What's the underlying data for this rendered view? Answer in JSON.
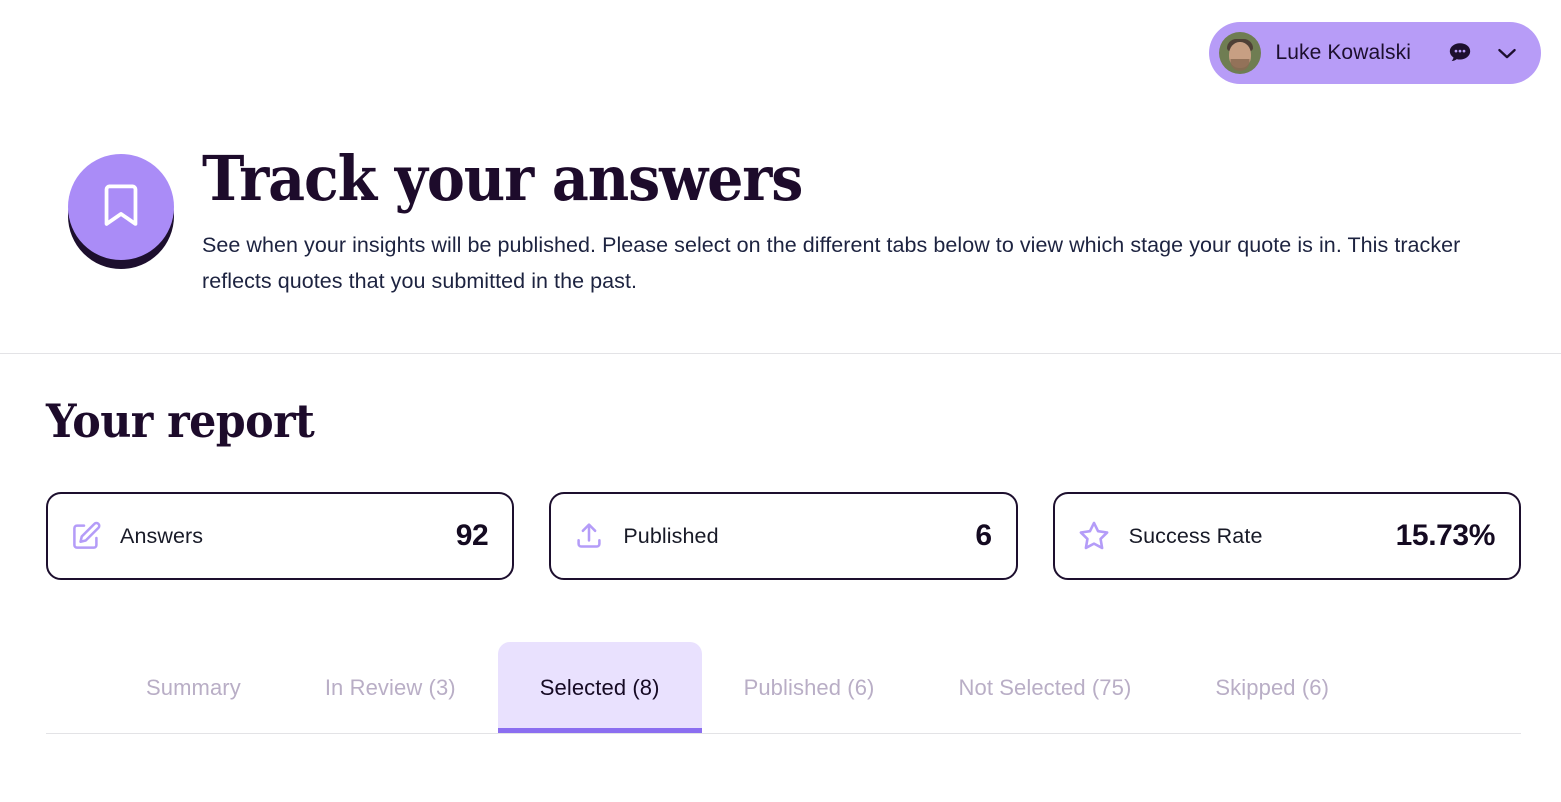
{
  "topbar": {
    "user_name": "Luke Kowalski",
    "avatar_alt": "user-avatar",
    "chat_icon": "chat-bubble-icon",
    "chevron_icon": "chevron-down-icon",
    "pill_color": "#b79cf7"
  },
  "hero": {
    "badge_icon": "bookmark-icon",
    "badge_color": "#aa8cf7",
    "title": "Track your answers",
    "description": "See when your insights will be published. Please select on the different tabs below to view which stage your quote is in. This tracker reflects quotes that you submitted in the past."
  },
  "report": {
    "title": "Your report",
    "cards": [
      {
        "icon": "edit-square-icon",
        "label": "Answers",
        "value": "92"
      },
      {
        "icon": "upload-icon",
        "label": "Published",
        "value": "6"
      },
      {
        "icon": "star-icon",
        "label": "Success Rate",
        "value": "15.73%"
      }
    ],
    "tabs": [
      {
        "label": "Summary",
        "active": false
      },
      {
        "label": "In Review (3)",
        "active": false
      },
      {
        "label": "Selected (8)",
        "active": true
      },
      {
        "label": "Published (6)",
        "active": false
      },
      {
        "label": "Not Selected (75)",
        "active": false
      },
      {
        "label": "Skipped (6)",
        "active": false
      }
    ]
  },
  "colors": {
    "accent_purple": "#8b6ef0",
    "light_purple": "#aa8cf7",
    "tab_active_bg": "#e9e1fe",
    "ink": "#1d0f2e",
    "muted": "#b9aec6"
  }
}
